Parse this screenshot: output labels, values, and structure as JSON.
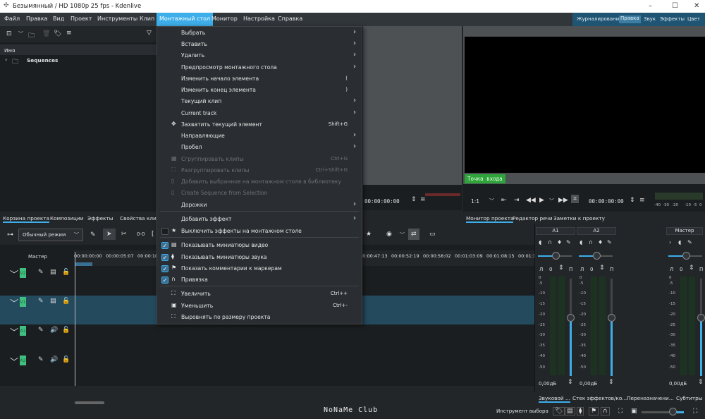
{
  "window": {
    "title": "Безымянный / HD 1080p 25 fps - Kdenlive",
    "min": "–",
    "max": "☐",
    "close": "✕"
  },
  "menubar": [
    "Файл",
    "Правка",
    "Вид",
    "Проект",
    "Инструменты",
    "Клип",
    "Монтажный стол",
    "Монитор",
    "Настройка",
    "Справка"
  ],
  "workspaces": [
    "Журналирование",
    "Правка",
    "Звук",
    "Эффекты",
    "Цвет"
  ],
  "bin": {
    "header": "Имя",
    "items": [
      "Sequences"
    ]
  },
  "left_tabs": [
    "Корзина проекта",
    "Композиции",
    "Эффекты",
    "Свойства клипа"
  ],
  "menu": {
    "items": [
      {
        "label": "Выбрать",
        "sub": true
      },
      {
        "label": "Вставить",
        "sub": true
      },
      {
        "label": "Удалить",
        "sub": true
      },
      {
        "label": "Предпросмотр монтажного стола",
        "sub": true
      },
      {
        "label": "Изменить начало элемента",
        "shortcut": "("
      },
      {
        "label": "Изменить конец элемента",
        "shortcut": ")"
      },
      {
        "label": "Текущий клип",
        "sub": true
      },
      {
        "label": "Current track",
        "sub": true
      },
      {
        "label": "Захватить текущий элемент",
        "shortcut": "Shift+G",
        "icon": "✥"
      },
      {
        "label": "Направляющие",
        "sub": true
      },
      {
        "label": "Пробел",
        "sub": true
      },
      {
        "label": "Сгруппировать клипы",
        "shortcut": "Ctrl+G",
        "disabled": true,
        "icon": "▦"
      },
      {
        "label": "Разгруппировать клипы",
        "shortcut": "Ctrl+Shift+G",
        "disabled": true,
        "icon": "⛶"
      },
      {
        "label": "Добавить выбранное на монтажном столе в библиотеку",
        "disabled": true,
        "icon": "▯"
      },
      {
        "label": "Create Sequence from Selection",
        "disabled": true,
        "icon": "▯"
      },
      {
        "label": "Дорожки",
        "sub": true
      },
      {
        "label": "Добавить эффект",
        "sub": true
      },
      {
        "label": "Выключить эффекты на монтажном столе",
        "check": false,
        "icon": "★"
      },
      {
        "label": "Показывать миниатюры видео",
        "check": true,
        "icon": "▤"
      },
      {
        "label": "Показывать миниатюры звука",
        "check": true,
        "icon": "⧫"
      },
      {
        "label": "Показать комментарии к маркерам",
        "check": true,
        "icon": "⚑"
      },
      {
        "label": "Привязка",
        "check": true,
        "icon": "∩"
      },
      {
        "label": "Увеличить",
        "shortcut": "Ctrl++",
        "icon": "⛶"
      },
      {
        "label": "Уменьшить",
        "shortcut": "Ctrl+-",
        "icon": "▣"
      },
      {
        "label": "Выровнять по размеру проекта",
        "icon": "⛶"
      }
    ]
  },
  "clip_monitor": {
    "timecode": "00:00:00:00"
  },
  "project_monitor": {
    "in_point": "Точка входа",
    "zoom": "1:1",
    "timecode": "00:00:00:00",
    "vu_scale": [
      "-40",
      "-30",
      "-20",
      "-10",
      "-5",
      "0"
    ]
  },
  "monitor_tabs": [
    "Монитор проекта",
    "Редактор речи",
    "Заметки к проекту"
  ],
  "timeline": {
    "mode": "Обычный режим",
    "master": "Мастер",
    "ruler": [
      "00:00:00:00",
      "00:00:05:07",
      "00:00:10",
      "00:00:47:13",
      "00:00:52:19",
      "00:00:58:02",
      "00:01:03:09",
      "00:01:08:15",
      "00:01:13"
    ],
    "tracks": [
      "V2",
      "V1",
      "A1",
      "A2"
    ]
  },
  "mixer": {
    "channels": [
      {
        "name": "A1",
        "pan": "0",
        "gain": "0,00дБ",
        "left": "Л",
        "right": "П"
      },
      {
        "name": "A2",
        "pan": "0",
        "gain": "0,00дБ",
        "left": "Л",
        "right": "П"
      },
      {
        "name": "Мастер",
        "pan": "0",
        "gain": "0,00дБ",
        "left": "Л",
        "right": "П"
      }
    ],
    "scale": [
      "0",
      "-5",
      "-10",
      "-15",
      "-20",
      "-25",
      "-30",
      "-35",
      "-40",
      "-50"
    ]
  },
  "bottom_tabs": [
    "Звуковой ...",
    "Стек эффектов/ко...",
    "Переназначени...",
    "Субтитры"
  ],
  "status": {
    "tool": "Инструмент выбора",
    "zoom_level": 0.75
  },
  "watermark": "NoNaMe Club"
}
